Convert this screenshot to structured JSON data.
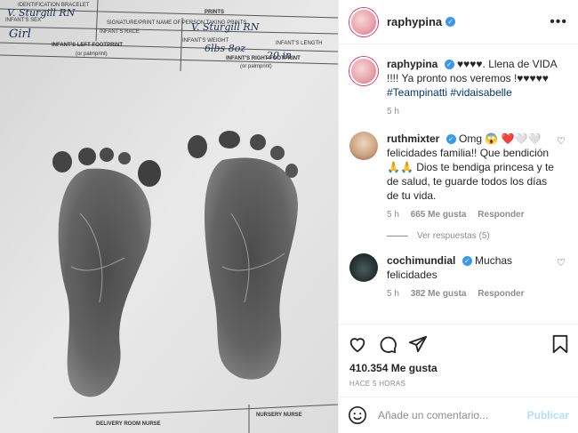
{
  "post": {
    "username": "raphypina",
    "verified_icon": "verified-badge-icon",
    "more_icon": "more-options-icon",
    "caption_text": "♥♥♥♥. Llena de VIDA !!!! Ya pronto nos veremos !♥♥♥♥♥",
    "hashtags": "#Teampinatti #vidaisabelle",
    "time": "5 h"
  },
  "photo": {
    "form_lines": [
      "IDENTIFICATION BRACELET",
      "PRINTS",
      "SIGNATURE/PRINT NAME OF PERSON TAKING PRINTS",
      "INFANT'S SEX",
      "INFANT'S RACE",
      "INFANT'S WEIGHT",
      "INFANT'S LENGTH",
      "INFANT'S LEFT FOOTPRINT",
      "(or palmprint)",
      "INFANT'S RIGHT FOOTPRINT",
      "(or palmprint)",
      "DELIVERY ROOM NURSE",
      "NURSERY NURSE"
    ],
    "handwriting": [
      "V. Sturgill RN",
      "V. Sturgill RN",
      "Girl",
      "6lbs 8oz",
      "20 in"
    ]
  },
  "comments": [
    {
      "username": "ruthmixter",
      "text": "Omg 😱 ❤️🤍🤍 felicidades familia!! Que bendición 🙏🙏 Dios te bendiga princesa y te de salud, te guarde todos los días de tu vida.",
      "time": "5 h",
      "likes": "665 Me gusta",
      "reply": "Responder",
      "replies_label": "Ver respuestas (5)"
    },
    {
      "username": "cochimundial",
      "text": "Muchas felicidades",
      "time": "5 h",
      "likes": "382 Me gusta",
      "reply": "Responder"
    }
  ],
  "actions": {
    "like_icon": "heart-icon",
    "comment_icon": "comment-icon",
    "share_icon": "share-icon",
    "save_icon": "bookmark-icon",
    "likes_count": "410.354 Me gusta",
    "posted_ago": "HACE 5 HORAS"
  },
  "add_comment": {
    "emoji_icon": "emoji-icon",
    "placeholder": "Añade un comentario...",
    "post_label": "Publicar"
  },
  "colors": {
    "link": "#00376b",
    "muted": "#8e8e8e",
    "verified": "#3897f0",
    "publish_disabled": "#b2dffc"
  }
}
